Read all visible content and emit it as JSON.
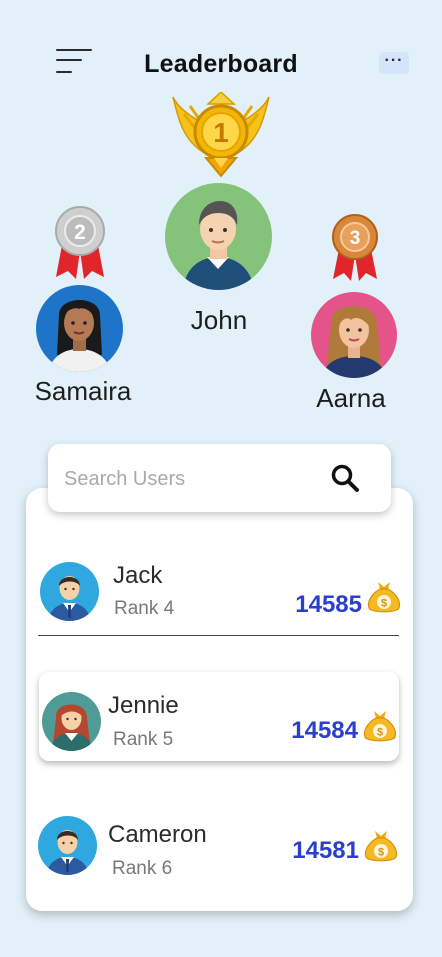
{
  "header": {
    "title": "Leaderboard",
    "more_label": "···"
  },
  "podium": [
    {
      "place": "1",
      "name": "John"
    },
    {
      "place": "2",
      "name": "Samaira"
    },
    {
      "place": "3",
      "name": "Aarna"
    }
  ],
  "search": {
    "placeholder": "Search Users"
  },
  "users": [
    {
      "name": "Jack",
      "rank": "Rank 4",
      "score": "14585"
    },
    {
      "name": "Jennie",
      "rank": "Rank 5",
      "score": "14584"
    },
    {
      "name": "Cameron",
      "rank": "Rank 6",
      "score": "14581"
    }
  ],
  "colors": {
    "background": "#e1f0f9",
    "score": "#2b3fcf",
    "gold": "#f2b705",
    "silver": "#c9c9c9",
    "bronze": "#d9883b",
    "ribbon": "#e0252b"
  }
}
